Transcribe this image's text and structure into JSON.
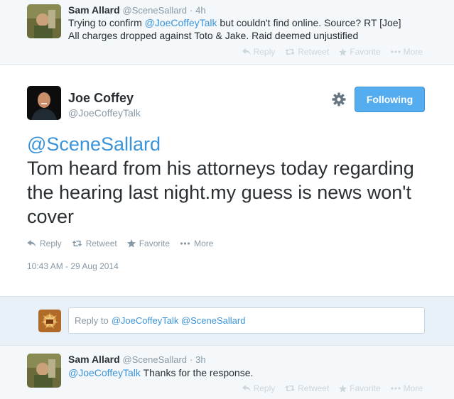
{
  "top_tweet": {
    "name": "Sam Allard",
    "handle": "@SceneSallard",
    "separator": "·",
    "time": "4h",
    "line1_prefix": "Trying to confirm ",
    "line1_mention": "@JoeCoffeyTalk",
    "line1_suffix": " but couldn't find online. Source? RT [Joe]",
    "line2": "All charges dropped against Toto & Jake. Raid deemed unjustified",
    "actions": {
      "reply": "Reply",
      "retweet": "Retweet",
      "favorite": "Favorite",
      "more": "More"
    }
  },
  "main_tweet": {
    "name": "Joe Coffey",
    "handle": "@JoeCoffeyTalk",
    "follow_label": "Following",
    "mention": "@SceneSallard",
    "text": "Tom heard from his attorneys today regarding the hearing last night.my guess is news won't cover",
    "actions": {
      "reply": "Reply",
      "retweet": "Retweet",
      "favorite": "Favorite",
      "more": "More"
    },
    "timestamp": "10:43 AM - 29 Aug 2014"
  },
  "reply_composer": {
    "prefix": "Reply to",
    "mentions": "@JoeCoffeyTalk @SceneSallard"
  },
  "bottom_tweet": {
    "name": "Sam Allard",
    "handle": "@SceneSallard",
    "separator": "·",
    "time": "3h",
    "mention": "@JoeCoffeyTalk",
    "text": " Thanks for the response.",
    "actions": {
      "reply": "Reply",
      "retweet": "Retweet",
      "favorite": "Favorite",
      "more": "More"
    }
  },
  "colors": {
    "link": "#3b94d9",
    "follow_button": "#55acee",
    "muted": "#8899a6",
    "background_alt": "#f5f8fa"
  },
  "icons": [
    "reply-icon",
    "retweet-icon",
    "favorite-icon",
    "more-icon",
    "gear-icon"
  ]
}
